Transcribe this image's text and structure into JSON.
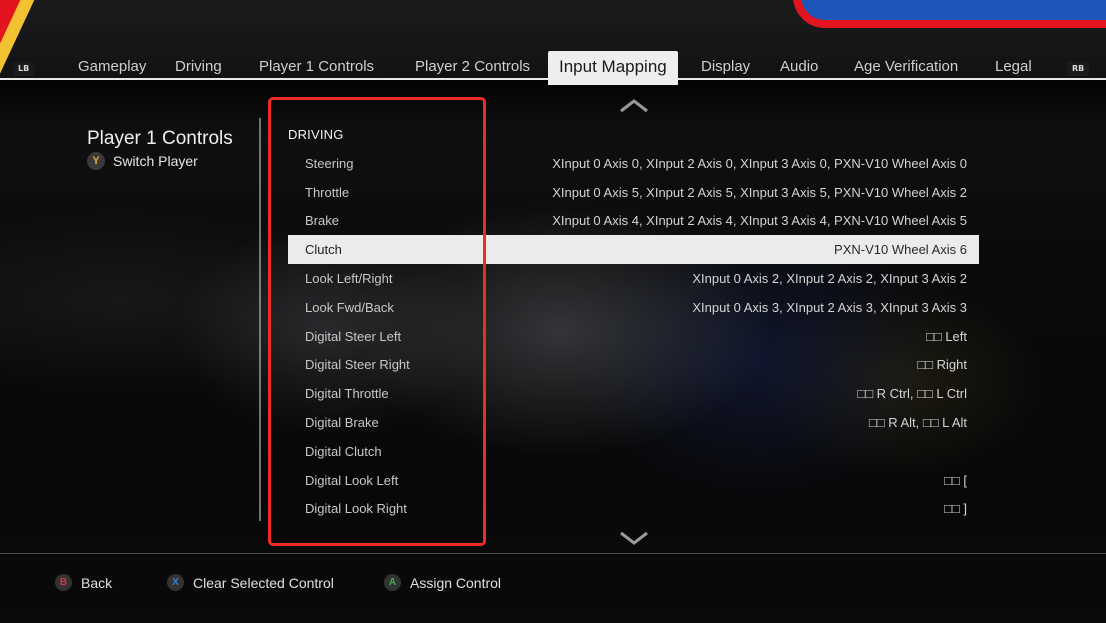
{
  "tabs": {
    "left_bumper": "LB",
    "right_bumper": "RB",
    "items": [
      {
        "label": "Gameplay",
        "active": false
      },
      {
        "label": "Driving",
        "active": false
      },
      {
        "label": "Player 1 Controls",
        "active": false
      },
      {
        "label": "Player 2 Controls",
        "active": false
      },
      {
        "label": "Input Mapping",
        "active": true
      },
      {
        "label": "Display",
        "active": false
      },
      {
        "label": "Audio",
        "active": false
      },
      {
        "label": "Age Verification",
        "active": false
      },
      {
        "label": "Legal",
        "active": false
      }
    ]
  },
  "left_panel": {
    "title": "Player 1 Controls",
    "switch_button": "Y",
    "switch_label": "Switch Player",
    "switch_button_color": "#d4b13a"
  },
  "list": {
    "section": "DRIVING",
    "scroll_up_icon": "chevron-up-icon",
    "scroll_down_icon": "chevron-down-icon",
    "rows": [
      {
        "action": "Steering",
        "binding": "XInput 0 Axis 0, XInput 2 Axis 0, XInput 3 Axis 0, PXN-V10 Wheel Axis 0",
        "selected": false
      },
      {
        "action": "Throttle",
        "binding": "XInput 0 Axis 5, XInput 2 Axis 5, XInput 3 Axis 5, PXN-V10 Wheel Axis 2",
        "selected": false
      },
      {
        "action": "Brake",
        "binding": "XInput 0 Axis 4, XInput 2 Axis 4, XInput 3 Axis 4, PXN-V10 Wheel Axis 5",
        "selected": false
      },
      {
        "action": "Clutch",
        "binding": "PXN-V10 Wheel Axis 6",
        "selected": true
      },
      {
        "action": "Look Left/Right",
        "binding": "XInput 0 Axis 2, XInput 2 Axis 2, XInput 3 Axis 2",
        "selected": false
      },
      {
        "action": "Look Fwd/Back",
        "binding": "XInput 0 Axis 3, XInput 2 Axis 3, XInput 3 Axis 3",
        "selected": false
      },
      {
        "action": "Digital Steer Left",
        "binding": "□□ Left",
        "selected": false
      },
      {
        "action": "Digital Steer Right",
        "binding": "□□ Right",
        "selected": false
      },
      {
        "action": "Digital Throttle",
        "binding": "□□ R Ctrl, □□ L Ctrl",
        "selected": false
      },
      {
        "action": "Digital Brake",
        "binding": "□□ R Alt, □□ L Alt",
        "selected": false
      },
      {
        "action": "Digital Clutch",
        "binding": "",
        "selected": false
      },
      {
        "action": "Digital Look Left",
        "binding": "□□ [",
        "selected": false
      },
      {
        "action": "Digital Look Right",
        "binding": "□□ ]",
        "selected": false
      }
    ]
  },
  "footer": {
    "hints": [
      {
        "button": "B",
        "label": "Back",
        "color": "#d9334a"
      },
      {
        "button": "X",
        "label": "Clear Selected Control",
        "color": "#3a7fd0"
      },
      {
        "button": "A",
        "label": "Assign Control",
        "color": "#3fae4a"
      }
    ]
  },
  "colors": {
    "highlight_box": "#ee2b24",
    "selected_row_bg": "#ebebeb",
    "active_tab_bg": "#eeeeee"
  }
}
